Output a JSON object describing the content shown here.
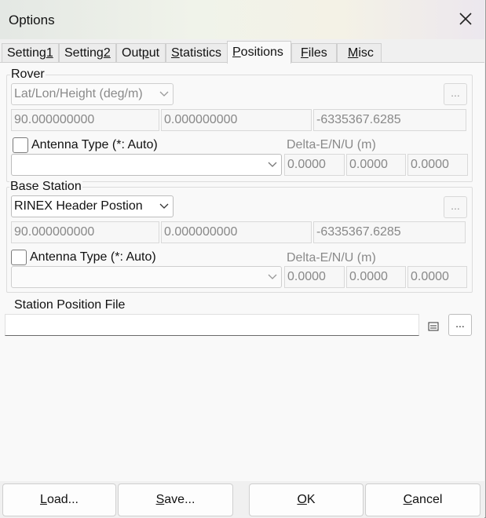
{
  "window": {
    "title": "Options"
  },
  "tabs": [
    {
      "label_pre": "Setting",
      "label_u": "1",
      "label_post": "",
      "active": false
    },
    {
      "label_pre": "Setting",
      "label_u": "2",
      "label_post": "",
      "active": false
    },
    {
      "label_pre": "Out",
      "label_u": "p",
      "label_post": "ut",
      "active": false
    },
    {
      "label_pre": "",
      "label_u": "S",
      "label_post": "tatistics",
      "active": false
    },
    {
      "label_pre": "",
      "label_u": "P",
      "label_post": "ositions",
      "active": true
    },
    {
      "label_pre": "",
      "label_u": "F",
      "label_post": "iles",
      "active": false
    },
    {
      "label_pre": "",
      "label_u": "M",
      "label_post": "isc",
      "active": false
    }
  ],
  "rover": {
    "group_label": "Rover",
    "position_type": "Lat/Lon/Height (deg/m)",
    "browse_label": "...",
    "pos1": "90.000000000",
    "pos2": "0.000000000",
    "pos3": "-6335367.6285",
    "antenna_label": "Antenna Type (*: Auto)",
    "delta_label": "Delta-E/N/U (m)",
    "antenna_value": "",
    "delta_e": "0.0000",
    "delta_n": "0.0000",
    "delta_u": "0.0000"
  },
  "base": {
    "group_label": "Base Station",
    "position_type": "RINEX Header Postion",
    "browse_label": "...",
    "pos1": "90.000000000",
    "pos2": "0.000000000",
    "pos3": "-6335367.6285",
    "antenna_label": "Antenna Type (*: Auto)",
    "delta_label": "Delta-E/N/U (m)",
    "antenna_value": "",
    "delta_e": "0.0000",
    "delta_n": "0.0000",
    "delta_u": "0.0000"
  },
  "station_file": {
    "label": "Station Position File",
    "value": "",
    "browse_label": "..."
  },
  "buttons": {
    "load": {
      "pre": "",
      "u": "L",
      "post": "oad..."
    },
    "save": {
      "pre": "",
      "u": "S",
      "post": "ave..."
    },
    "ok": {
      "pre": "",
      "u": "O",
      "post": "K"
    },
    "cancel": {
      "pre": "",
      "u": "C",
      "post": "ancel"
    }
  }
}
